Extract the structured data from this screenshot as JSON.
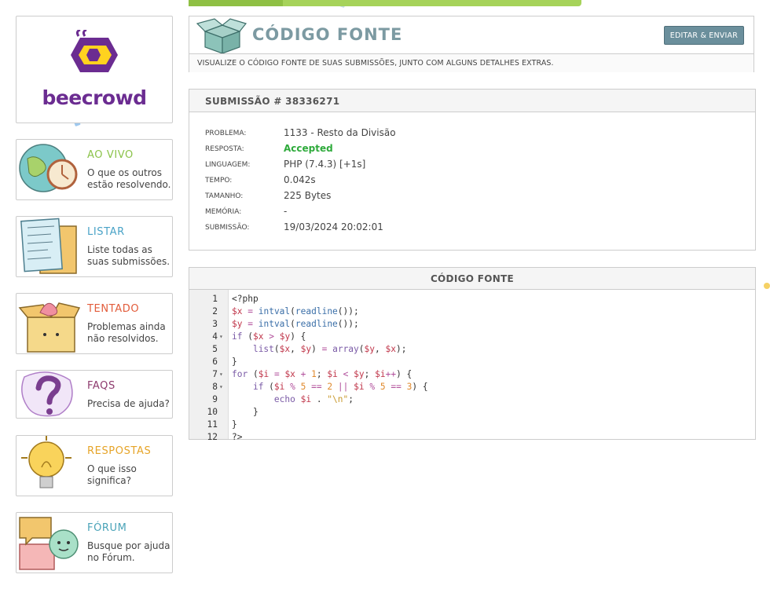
{
  "brand": {
    "name": "beecrowd"
  },
  "sidebar": {
    "cards": [
      {
        "title": "AO VIVO",
        "desc": "O que os outros estão resolvendo.",
        "color": "#8bc34a"
      },
      {
        "title": "LISTAR",
        "desc": "Liste todas as suas submissões.",
        "color": "#4aa3c7"
      },
      {
        "title": "TENTADO",
        "desc": "Problemas ainda não resolvidos.",
        "color": "#e25c3b"
      },
      {
        "title": "FAQS",
        "desc": "Precisa de ajuda?",
        "color": "#8e3b6e"
      },
      {
        "title": "RESPOSTAS",
        "desc": "O que isso significa?",
        "color": "#e6a428"
      },
      {
        "title": "FÓRUM",
        "desc": "Busque por ajuda no Fórum.",
        "color": "#4aa3b8"
      }
    ]
  },
  "header": {
    "title": "CÓDIGO FONTE",
    "edit_button": "EDITAR & ENVIAR",
    "subtitle": "VISUALIZE O CÓDIGO FONTE DE SUAS SUBMISSÕES, JUNTO COM ALGUNS DETALHES EXTRAS."
  },
  "submission": {
    "heading": "SUBMISSÃO # 38336271",
    "rows": [
      {
        "label": "PROBLEMA:",
        "value": "1133 - Resto da Divisão"
      },
      {
        "label": "RESPOSTA:",
        "value": "Accepted",
        "status_color": "#2eaa3b"
      },
      {
        "label": "LINGUAGEM:",
        "value": "PHP (7.4.3) [+1s]"
      },
      {
        "label": "TEMPO:",
        "value": "0.042s"
      },
      {
        "label": "TAMANHO:",
        "value": "225 Bytes"
      },
      {
        "label": "MEMÓRIA:",
        "value": "-"
      },
      {
        "label": "SUBMISSÃO:",
        "value": "19/03/2024 20:02:01"
      }
    ]
  },
  "code": {
    "heading": "CÓDIGO FONTE",
    "lines": [
      {
        "num": "1",
        "fold": false,
        "text": "<?php"
      },
      {
        "num": "2",
        "fold": false,
        "text": "$x = intval(readline());"
      },
      {
        "num": "3",
        "fold": false,
        "text": "$y = intval(readline());"
      },
      {
        "num": "4",
        "fold": true,
        "text": "if ($x > $y) {"
      },
      {
        "num": "5",
        "fold": false,
        "text": "    list($x, $y) = array($y, $x);"
      },
      {
        "num": "6",
        "fold": false,
        "text": "}"
      },
      {
        "num": "7",
        "fold": true,
        "text": "for ($i = $x + 1; $i < $y; $i++) {"
      },
      {
        "num": "8",
        "fold": true,
        "text": "    if ($i % 5 == 2 || $i % 5 == 3) {"
      },
      {
        "num": "9",
        "fold": false,
        "text": "        echo $i . \"\\n\";"
      },
      {
        "num": "10",
        "fold": false,
        "text": "    }"
      },
      {
        "num": "11",
        "fold": false,
        "text": "}"
      },
      {
        "num": "12",
        "fold": false,
        "text": "?>"
      }
    ]
  },
  "icons": {
    "logo": "bee-hexagon-logo-icon",
    "ao_vivo": "globe-clock-icon",
    "listar": "notes-list-icon",
    "tentado": "open-box-icon",
    "faqs": "question-mark-icon",
    "respostas": "light-bulb-icon",
    "forum": "chat-bubbles-icon",
    "header": "open-box-icon"
  }
}
